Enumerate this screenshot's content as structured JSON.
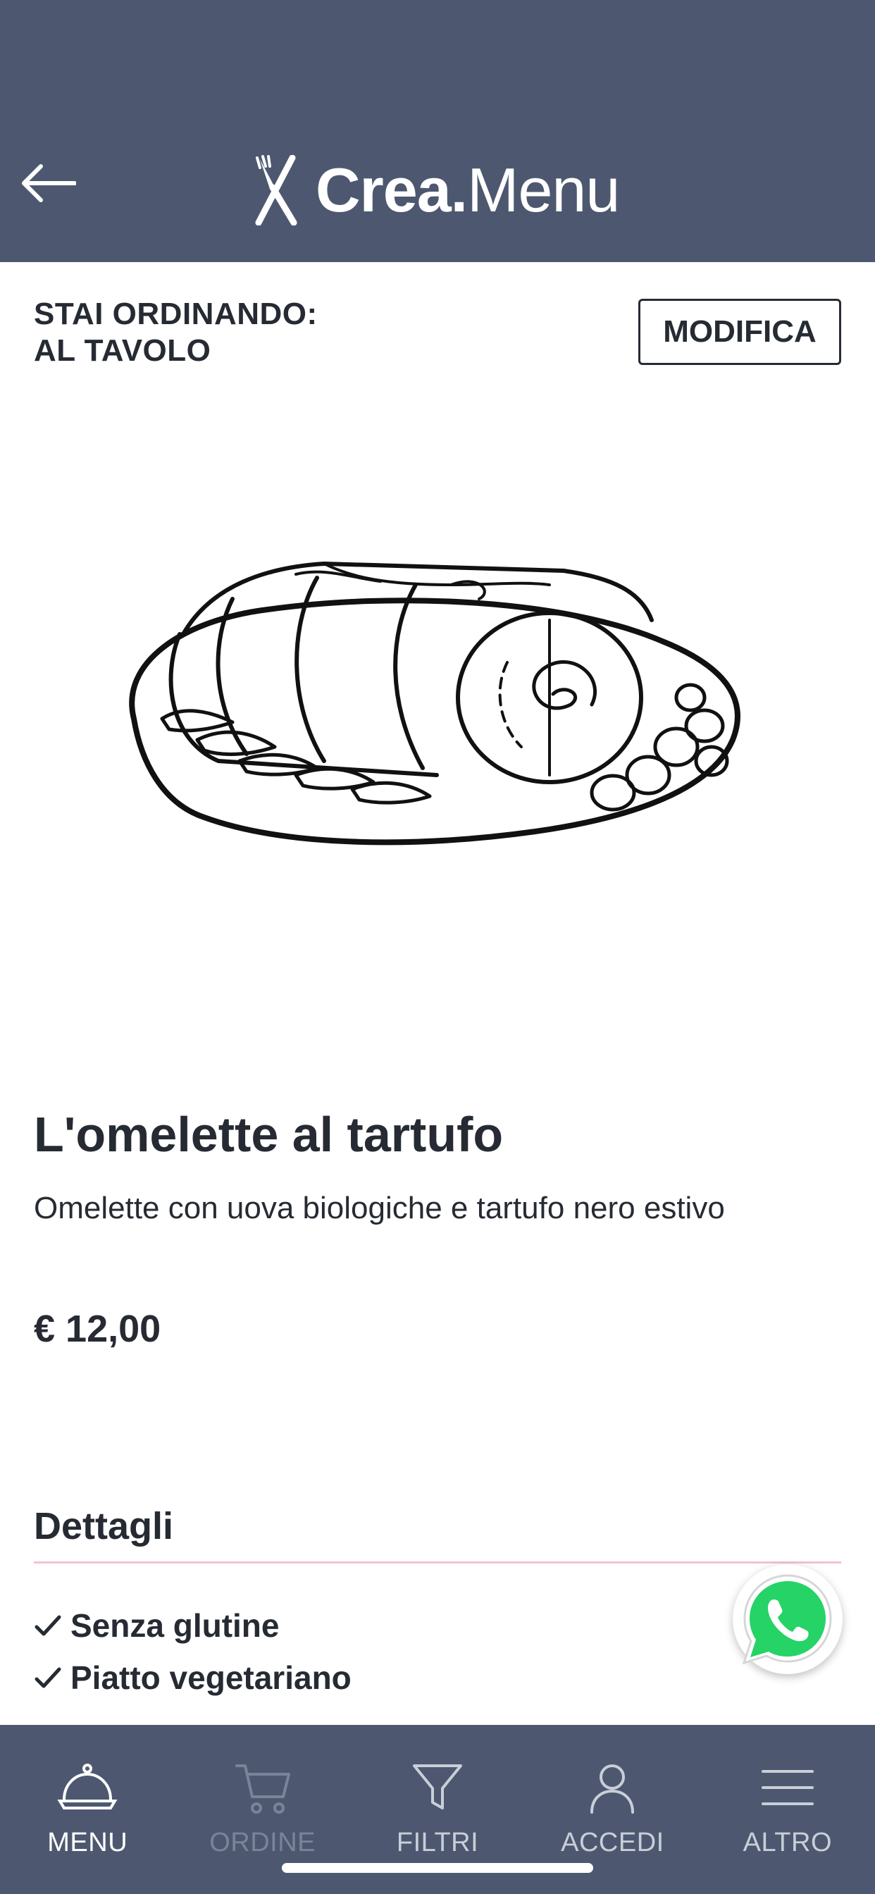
{
  "header": {
    "logo_bold": "Crea.",
    "logo_light": "Menu",
    "back_icon": "arrow-left-icon",
    "colors": {
      "background": "#4d5870",
      "text": "#ffffff"
    }
  },
  "order": {
    "label_line1": "STAI ORDINANDO:",
    "label_line2": "AL TAVOLO",
    "modify_label": "MODIFICA"
  },
  "dish": {
    "image_icon": "rolled-roast-illustration",
    "title": "L'omelette al tartufo",
    "description": "Omelette con uova biologiche e tartufo nero estivo",
    "price": "€ 12,00"
  },
  "details": {
    "title": "Dettagli",
    "items": [
      "Senza glutine",
      "Piatto vegetariano"
    ],
    "divider_color": "#f2c2d2"
  },
  "whatsapp": {
    "icon": "whatsapp-icon",
    "color": "#25d366"
  },
  "nav": {
    "items": [
      {
        "label": "MENU",
        "icon": "cloche-icon",
        "state": "active"
      },
      {
        "label": "ORDINE",
        "icon": "cart-icon",
        "state": "disabled"
      },
      {
        "label": "FILTRI",
        "icon": "filter-icon",
        "state": "normal"
      },
      {
        "label": "ACCEDI",
        "icon": "user-icon",
        "state": "normal"
      },
      {
        "label": "ALTRO",
        "icon": "hamburger-icon",
        "state": "normal"
      }
    ]
  }
}
